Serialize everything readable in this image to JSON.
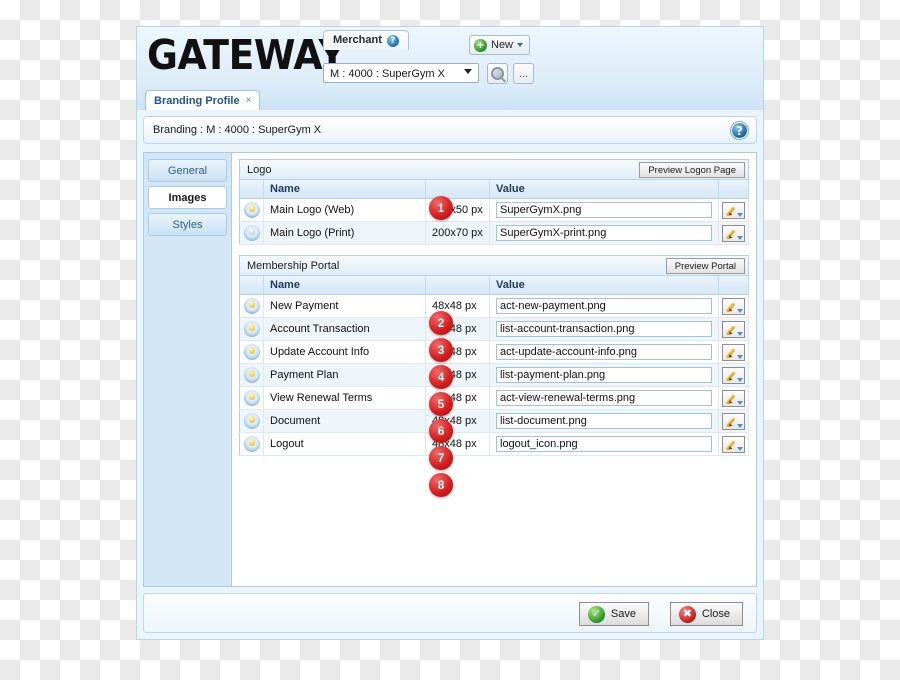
{
  "app": {
    "logo_text": "GATEWAY",
    "merchant_tab_label": "Merchant",
    "merchant_help_icon": "question-mark-icon",
    "merchant_select_value": "M : 4000 : SuperGym X",
    "search_icon": "magnifier-icon",
    "more_button_label": "...",
    "new_button_label": "New",
    "new_button_icon": "green-plus-icon"
  },
  "tabs": [
    {
      "label": "Branding Profile",
      "close": "×"
    }
  ],
  "breadcrumb": {
    "text": "Branding : M : 4000 : SuperGym X",
    "help_icon": "question-mark-icon"
  },
  "sidebar": {
    "items": [
      {
        "label": "General",
        "active": false
      },
      {
        "label": "Images",
        "active": true
      },
      {
        "label": "Styles",
        "active": false
      }
    ]
  },
  "sections": [
    {
      "title": "Logo",
      "preview_button": "Preview Logon Page",
      "columns": [
        "",
        "Name",
        "",
        "Value",
        ""
      ],
      "rows": [
        {
          "icon": "lightbulb-on-icon",
          "name": "Main Logo (Web)",
          "size": "200x50 px",
          "value": "SuperGymX.png",
          "edit_icon": "pencil-icon",
          "badge": "1"
        },
        {
          "icon": "lightbulb-off-icon",
          "name": "Main Logo (Print)",
          "size": "200x70 px",
          "value": "SuperGymX-print.png",
          "edit_icon": "pencil-icon",
          "badge": ""
        }
      ]
    },
    {
      "title": "Membership Portal",
      "preview_button": "Preview Portal",
      "columns": [
        "",
        "Name",
        "",
        "Value",
        ""
      ],
      "rows": [
        {
          "icon": "lightbulb-on-icon",
          "name": "New Payment",
          "size": "48x48 px",
          "value": "act-new-payment.png",
          "edit_icon": "pencil-icon",
          "badge": "2"
        },
        {
          "icon": "lightbulb-on-icon",
          "name": "Account Transaction",
          "size": "48x48 px",
          "value": "list-account-transaction.png",
          "edit_icon": "pencil-icon",
          "badge": "3"
        },
        {
          "icon": "lightbulb-on-icon",
          "name": "Update Account Info",
          "size": "48x48 px",
          "value": "act-update-account-info.png",
          "edit_icon": "pencil-icon",
          "badge": "4"
        },
        {
          "icon": "lightbulb-on-icon",
          "name": "Payment Plan",
          "size": "48x48 px",
          "value": "list-payment-plan.png",
          "edit_icon": "pencil-icon",
          "badge": "5"
        },
        {
          "icon": "lightbulb-on-icon",
          "name": "View Renewal Terms",
          "size": "48x48 px",
          "value": "act-view-renewal-terms.png",
          "edit_icon": "pencil-icon",
          "badge": "6"
        },
        {
          "icon": "lightbulb-on-icon",
          "name": "Document",
          "size": "48x48 px",
          "value": "list-document.png",
          "edit_icon": "pencil-icon",
          "badge": "7"
        },
        {
          "icon": "lightbulb-on-icon",
          "name": "Logout",
          "size": "48x48 px",
          "value": "logout_icon.png",
          "edit_icon": "pencil-icon",
          "badge": "8"
        }
      ]
    }
  ],
  "footer": {
    "save_label": "Save",
    "save_icon": "green-check-icon",
    "close_label": "Close",
    "close_icon": "red-x-icon"
  },
  "colors": {
    "badge_red": "#d81f1f",
    "accent_blue": "#22558c",
    "panel_blue": "#d3e6f5",
    "frame_border": "#b9d4e8"
  }
}
